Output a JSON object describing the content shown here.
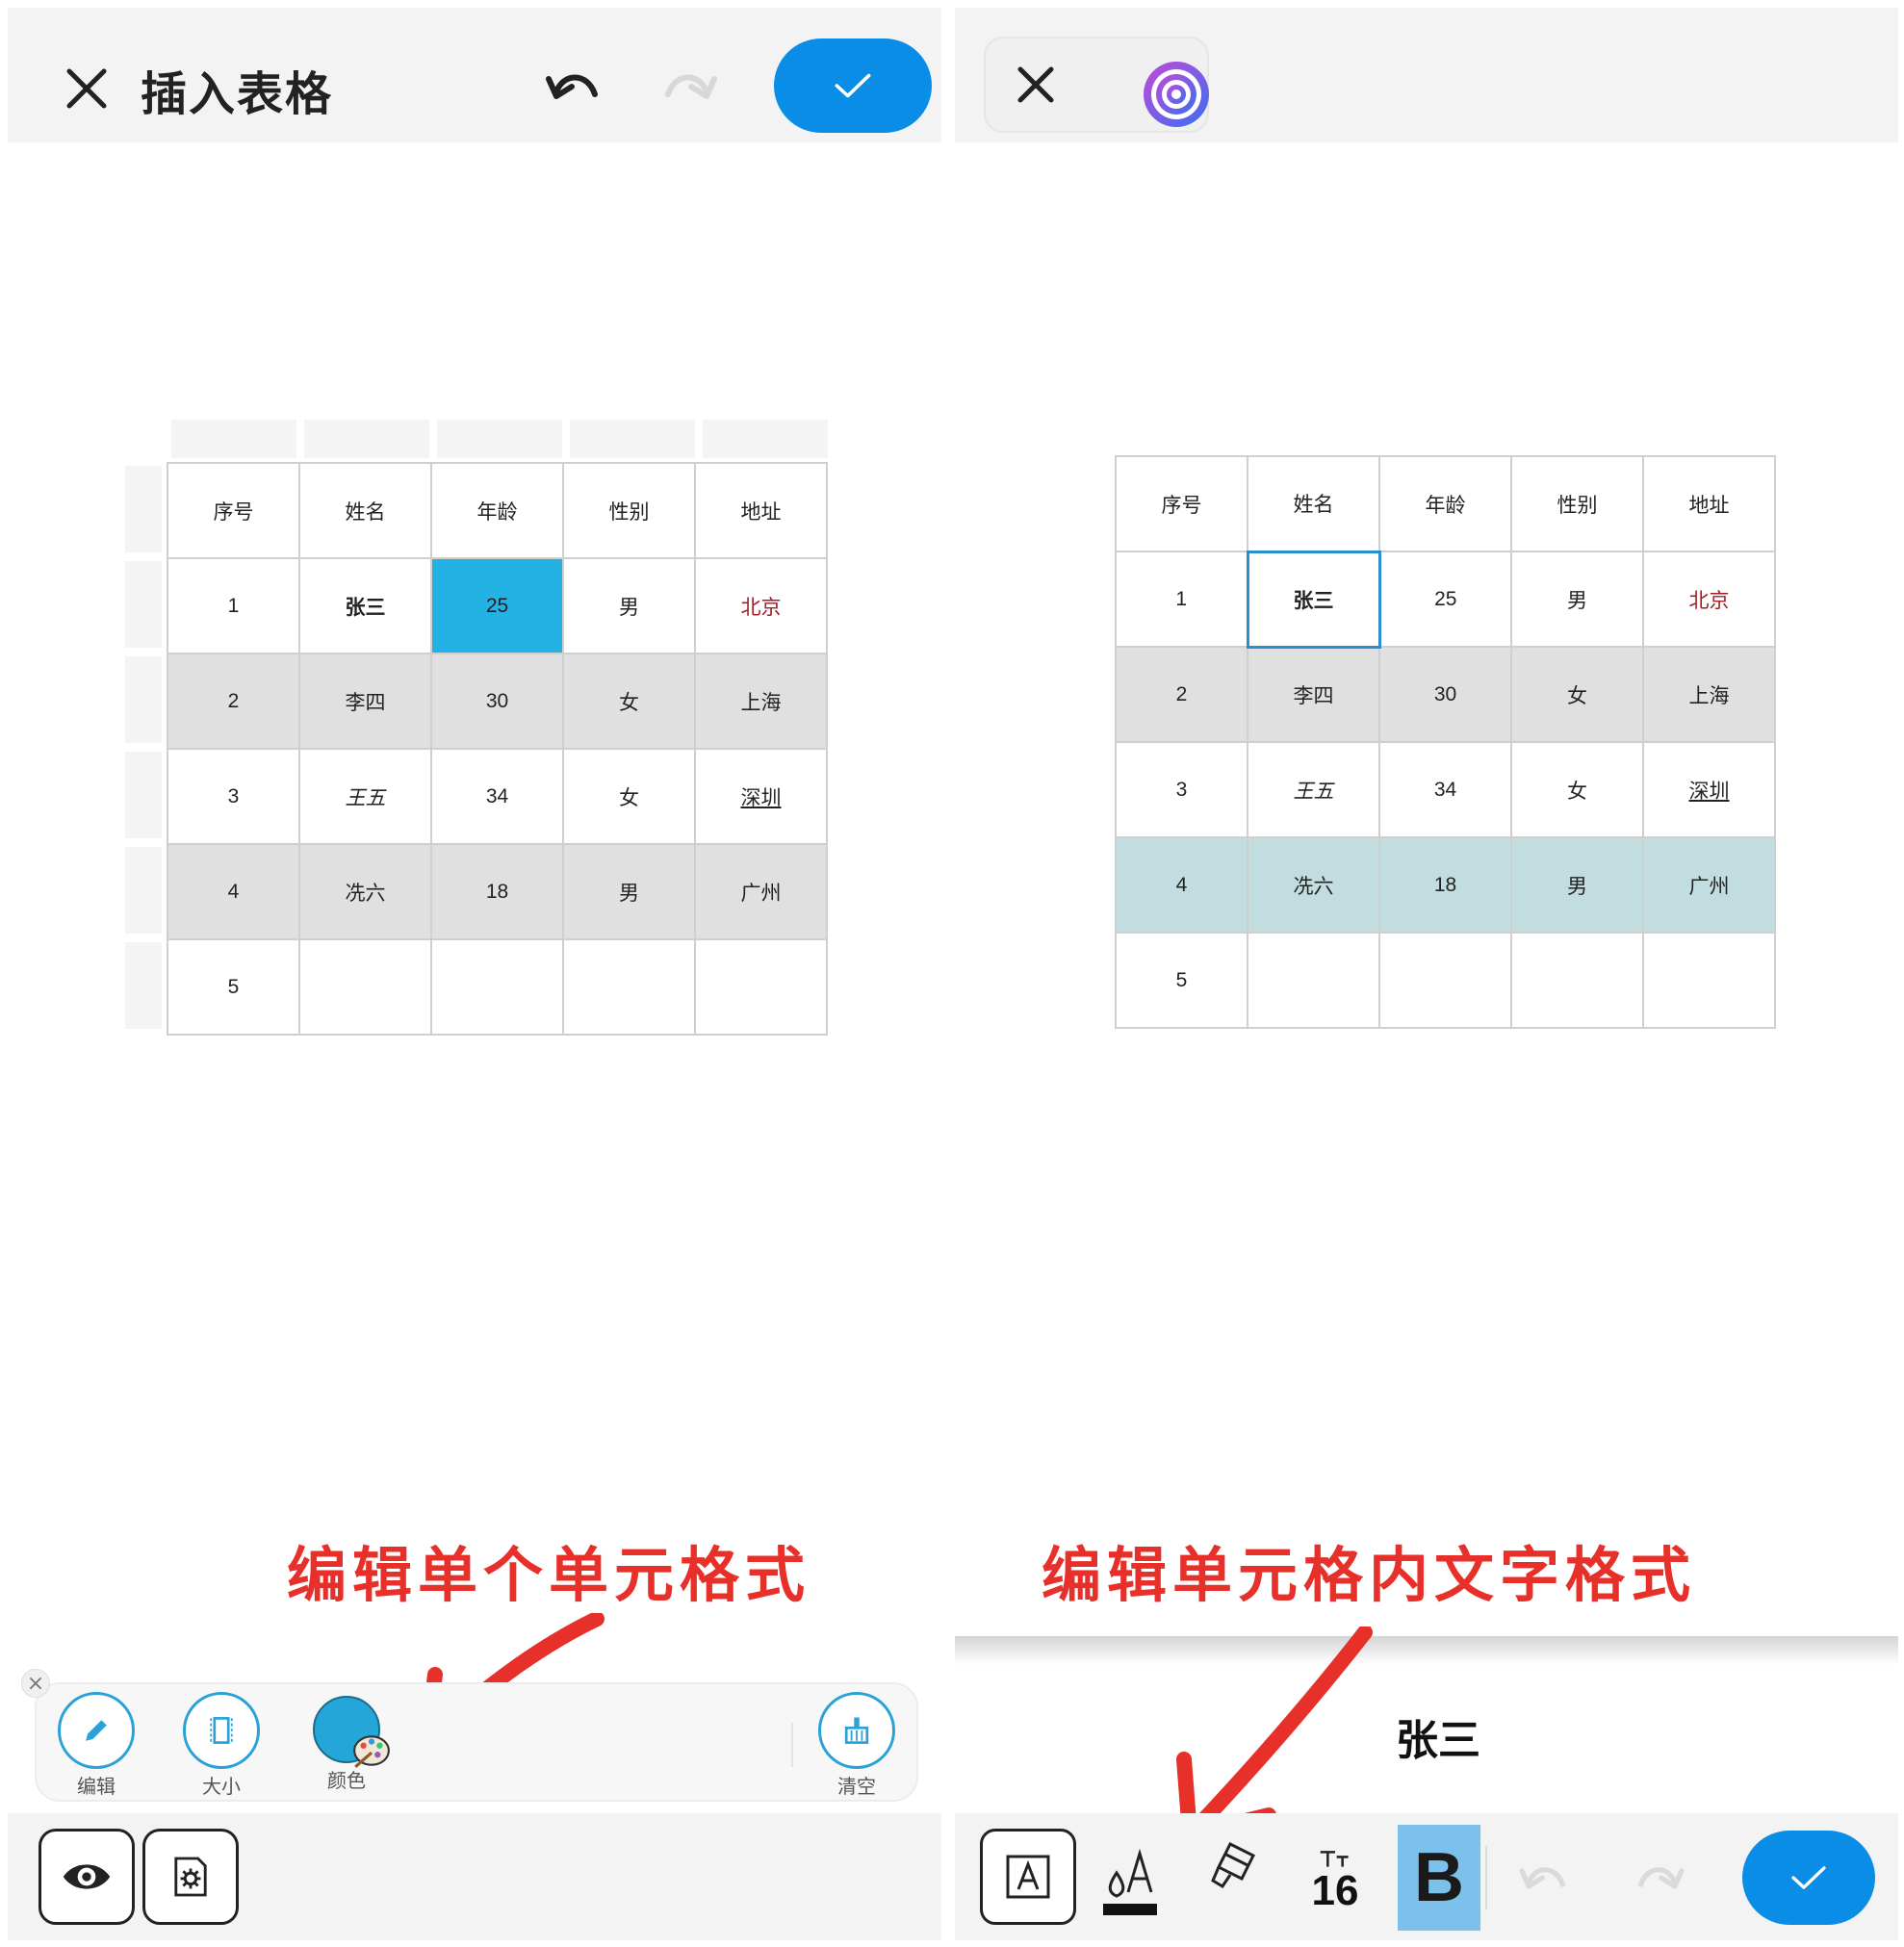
{
  "left": {
    "header": {
      "title": "插入表格"
    },
    "table": {
      "rows": [
        [
          "序号",
          "姓名",
          "年龄",
          "性别",
          "地址"
        ],
        [
          "1",
          "张三",
          "25",
          "男",
          "北京"
        ],
        [
          "2",
          "李四",
          "30",
          "女",
          "上海"
        ],
        [
          "3",
          "王五",
          "34",
          "女",
          "深圳"
        ],
        [
          "4",
          "冼六",
          "18",
          "男",
          "广州"
        ],
        [
          "5",
          "",
          "",
          "",
          ""
        ]
      ]
    },
    "annotation": "编辑单个单元格式",
    "palette": {
      "edit_label": "编辑",
      "size_label": "大小",
      "color_label": "颜色",
      "clear_label": "清空"
    },
    "colors": {
      "accent": "#0a8de6",
      "selected_cell": "#24b1e4",
      "alt_row": "#e0e0e0",
      "address_red": "#a0202a"
    }
  },
  "right": {
    "table": {
      "rows": [
        [
          "序号",
          "姓名",
          "年龄",
          "性别",
          "地址"
        ],
        [
          "1",
          "张三",
          "25",
          "男",
          "北京"
        ],
        [
          "2",
          "李四",
          "30",
          "女",
          "上海"
        ],
        [
          "3",
          "王五",
          "34",
          "女",
          "深圳"
        ],
        [
          "4",
          "冼六",
          "18",
          "男",
          "广州"
        ],
        [
          "5",
          "",
          "",
          "",
          ""
        ]
      ]
    },
    "annotation": "编辑单元格内文字格式",
    "editor": {
      "text": "张三"
    },
    "format_bar": {
      "font_size": "16",
      "bold_label": "B"
    },
    "colors": {
      "highlight_row": "#c2dddf",
      "bold_active": "#7cc0ec"
    }
  }
}
